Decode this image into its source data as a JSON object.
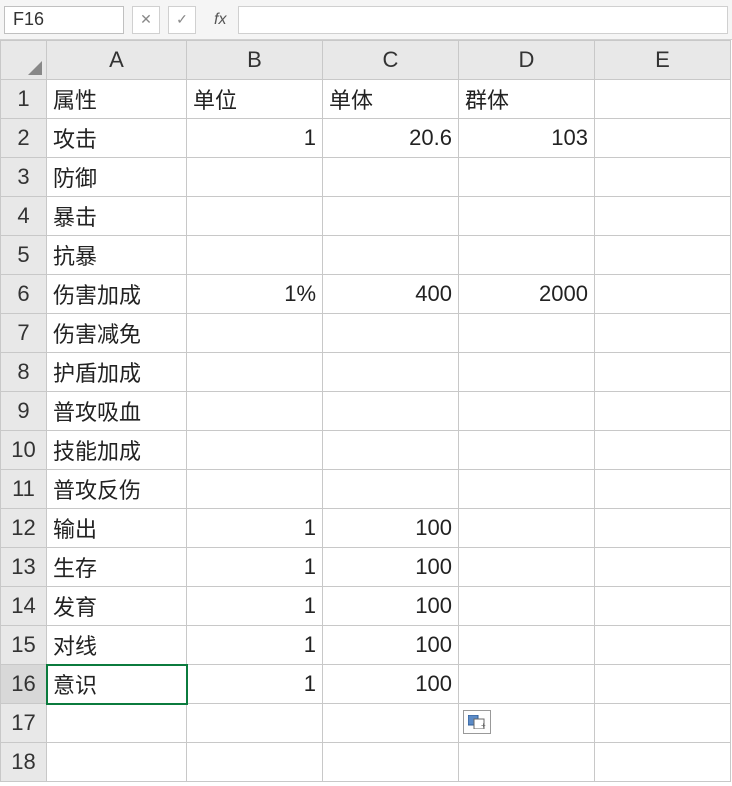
{
  "toolbar": {
    "name_box": "F16",
    "cancel": "✕",
    "confirm": "✓",
    "fx": "fx"
  },
  "columns": [
    "A",
    "B",
    "C",
    "D",
    "E"
  ],
  "rows": [
    {
      "n": "1",
      "A": "属性",
      "B": "单位",
      "C": "单体",
      "D": "群体",
      "E": ""
    },
    {
      "n": "2",
      "A": "攻击",
      "B": "1",
      "C": "20.6",
      "D": "103",
      "E": ""
    },
    {
      "n": "3",
      "A": "防御",
      "B": "",
      "C": "",
      "D": "",
      "E": ""
    },
    {
      "n": "4",
      "A": "暴击",
      "B": "",
      "C": "",
      "D": "",
      "E": ""
    },
    {
      "n": "5",
      "A": "抗暴",
      "B": "",
      "C": "",
      "D": "",
      "E": ""
    },
    {
      "n": "6",
      "A": "伤害加成",
      "B": "1%",
      "C": "400",
      "D": "2000",
      "E": ""
    },
    {
      "n": "7",
      "A": "伤害减免",
      "B": "",
      "C": "",
      "D": "",
      "E": ""
    },
    {
      "n": "8",
      "A": "护盾加成",
      "B": "",
      "C": "",
      "D": "",
      "E": ""
    },
    {
      "n": "9",
      "A": "普攻吸血",
      "B": "",
      "C": "",
      "D": "",
      "E": ""
    },
    {
      "n": "10",
      "A": "技能加成",
      "B": "",
      "C": "",
      "D": "",
      "E": ""
    },
    {
      "n": "11",
      "A": "普攻反伤",
      "B": "",
      "C": "",
      "D": "",
      "E": ""
    },
    {
      "n": "12",
      "A": "输出",
      "B": "1",
      "C": "100",
      "D": "",
      "E": ""
    },
    {
      "n": "13",
      "A": "生存",
      "B": "1",
      "C": "100",
      "D": "",
      "E": ""
    },
    {
      "n": "14",
      "A": "发育",
      "B": "1",
      "C": "100",
      "D": "",
      "E": ""
    },
    {
      "n": "15",
      "A": "对线",
      "B": "1",
      "C": "100",
      "D": "",
      "E": ""
    },
    {
      "n": "16",
      "A": "意识",
      "B": "1",
      "C": "100",
      "D": "",
      "E": ""
    },
    {
      "n": "17",
      "A": "",
      "B": "",
      "C": "",
      "D": "",
      "E": ""
    },
    {
      "n": "18",
      "A": "",
      "B": "",
      "C": "",
      "D": "",
      "E": ""
    }
  ],
  "align": {
    "A": "left",
    "B": "right",
    "C": "right",
    "D": "right",
    "E": "left"
  },
  "header_align_override": {
    "1": {
      "B": "left",
      "C": "left",
      "D": "left"
    }
  },
  "active_cell": {
    "row": "16",
    "col": "A"
  },
  "chart_data": {
    "type": "table",
    "title": "",
    "columns": [
      "属性",
      "单位",
      "单体",
      "群体"
    ],
    "rows": [
      [
        "攻击",
        "1",
        "20.6",
        "103"
      ],
      [
        "防御",
        "",
        "",
        ""
      ],
      [
        "暴击",
        "",
        "",
        ""
      ],
      [
        "抗暴",
        "",
        "",
        ""
      ],
      [
        "伤害加成",
        "1%",
        "400",
        "2000"
      ],
      [
        "伤害减免",
        "",
        "",
        ""
      ],
      [
        "护盾加成",
        "",
        "",
        ""
      ],
      [
        "普攻吸血",
        "",
        "",
        ""
      ],
      [
        "技能加成",
        "",
        "",
        ""
      ],
      [
        "普攻反伤",
        "",
        "",
        ""
      ],
      [
        "输出",
        "1",
        "100",
        ""
      ],
      [
        "生存",
        "1",
        "100",
        ""
      ],
      [
        "发育",
        "1",
        "100",
        ""
      ],
      [
        "对线",
        "1",
        "100",
        ""
      ],
      [
        "意识",
        "1",
        "100",
        ""
      ]
    ]
  }
}
